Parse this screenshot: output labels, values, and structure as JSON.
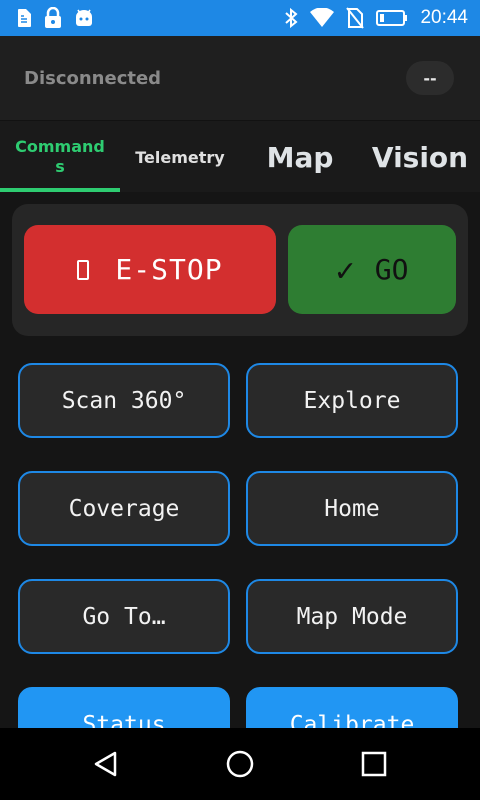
{
  "status_bar": {
    "time": "20:44",
    "left_icons": [
      "sim-card-icon",
      "lock-icon",
      "android-icon"
    ],
    "right_icons": [
      "bluetooth-icon",
      "wifi-icon",
      "no-sim-icon",
      "battery-icon"
    ],
    "color": "#1e88e5"
  },
  "connection": {
    "status": "Disconnected",
    "indicator": "--"
  },
  "tabs": [
    {
      "label": "Commands",
      "active": true
    },
    {
      "label": "Telemetry",
      "active": false
    },
    {
      "label": "Map",
      "active": false
    },
    {
      "label": "Vision",
      "active": false
    }
  ],
  "tab_accent": "#2ecc71",
  "controls": {
    "estop_label": "E-STOP",
    "estop_icon": "stop-square-icon",
    "go_label": "GO",
    "go_icon": "checkmark-icon",
    "estop_color": "#d32f2f",
    "go_color": "#2e7d32"
  },
  "commands": [
    {
      "label": "Scan 360°"
    },
    {
      "label": "Explore"
    },
    {
      "label": "Coverage"
    },
    {
      "label": "Home"
    },
    {
      "label": "Go To…"
    },
    {
      "label": "Map Mode"
    },
    {
      "label": "Status"
    },
    {
      "label": "Calibrate"
    }
  ],
  "command_border_color": "#1e88e5",
  "nav_bar": {
    "icons": [
      "back-triangle-icon",
      "home-circle-icon",
      "recents-square-icon"
    ]
  }
}
